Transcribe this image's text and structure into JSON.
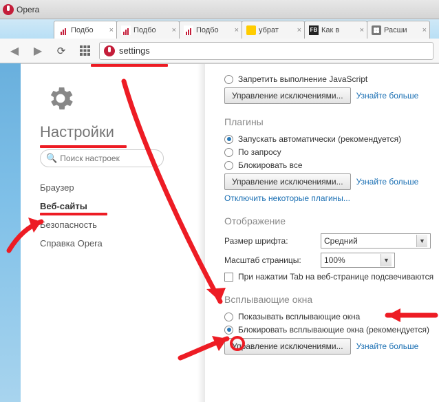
{
  "titlebar": {
    "app_name": "Opera"
  },
  "tabs": [
    {
      "label": "Подбо",
      "fav": "red",
      "active": true
    },
    {
      "label": "Подбо",
      "fav": "red"
    },
    {
      "label": "Подбо",
      "fav": "red"
    },
    {
      "label": "убрат",
      "fav": "y"
    },
    {
      "label": "Как в",
      "fav": "fb"
    },
    {
      "label": "Расши",
      "fav": "ext"
    }
  ],
  "address": {
    "text": "settings"
  },
  "sidebar": {
    "title": "Настройки",
    "search_placeholder": "Поиск настроек",
    "items": [
      {
        "label": "Браузер"
      },
      {
        "label": "Веб-сайты",
        "active": true
      },
      {
        "label": "Безопасность"
      },
      {
        "label": "Справка Opera"
      }
    ]
  },
  "main": {
    "js_block": "Запретить выполнение JavaScript",
    "manage_exceptions": "Управление исключениями...",
    "learn_more": "Узнайте больше",
    "plugins_head": "Плагины",
    "plugins_auto": "Запускать автоматически (рекомендуется)",
    "plugins_ondemand": "По запросу",
    "plugins_block": "Блокировать все",
    "disable_some": "Отключить некоторые плагины...",
    "display_head": "Отображение",
    "font_size_label": "Размер шрифта:",
    "font_size_value": "Средний",
    "zoom_label": "Масштаб страницы:",
    "zoom_value": "100%",
    "tab_highlight": "При нажатии Tab на веб-странице подсвечиваются",
    "popups_head": "Всплывающие окна",
    "popups_show": "Показывать всплывающие окна",
    "popups_block": "Блокировать всплывающие окна (рекомендуется)"
  }
}
